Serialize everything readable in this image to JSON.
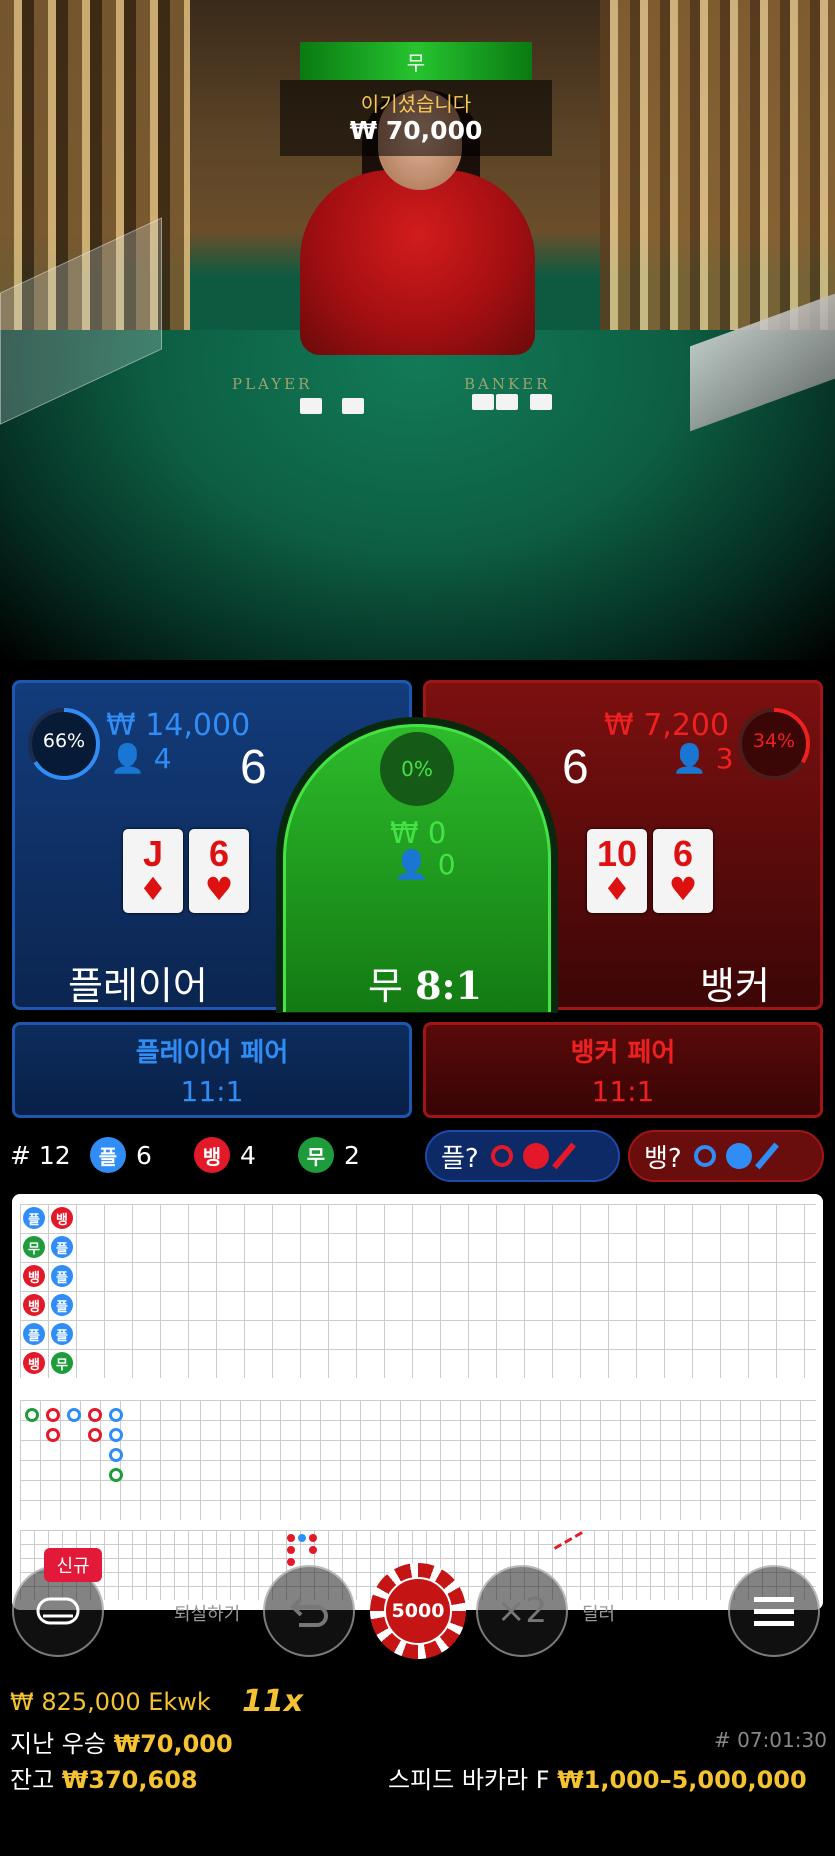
{
  "result": {
    "label": "무",
    "message": "이기셨습니다",
    "amount": "₩ 70,000"
  },
  "table_felt": {
    "player_text": "PLAYER",
    "banker_text": "BANKER"
  },
  "player": {
    "percent": "66%",
    "percent_value": 0.66,
    "bet_total": "₩ 14,000",
    "bettors": "4",
    "score": "6",
    "cards": [
      {
        "rank": "J",
        "suit": "♦"
      },
      {
        "rank": "6",
        "suit": "♥"
      }
    ],
    "label": "플레이어"
  },
  "tie": {
    "percent": "0%",
    "bet_total": "₩ 0",
    "bettors": "0",
    "label": "무",
    "payout": "8:1"
  },
  "banker": {
    "percent": "34%",
    "percent_value": 0.34,
    "bet_total": "₩ 7,200",
    "bettors": "3",
    "score": "6",
    "cards": [
      {
        "rank": "10",
        "suit": "♦"
      },
      {
        "rank": "6",
        "suit": "♥"
      }
    ],
    "label": "뱅커"
  },
  "pairs": {
    "player_pair": {
      "label": "플레이어 페어",
      "payout": "11:1"
    },
    "banker_pair": {
      "label": "뱅커 페어",
      "payout": "11:1"
    }
  },
  "stats": {
    "round": "# 12",
    "player": {
      "glyph": "플",
      "count": "6"
    },
    "banker": {
      "glyph": "뱅",
      "count": "4"
    },
    "tie": {
      "glyph": "무",
      "count": "2"
    }
  },
  "predict": {
    "player_label": "플?",
    "banker_label": "뱅?"
  },
  "roadmap": {
    "bead_columns": [
      [
        "플",
        "무",
        "뱅",
        "뱅",
        "플",
        "뱅"
      ],
      [
        "뱅",
        "플",
        "플",
        "플",
        "플",
        "무"
      ]
    ]
  },
  "controls": {
    "lobby_label": "퇴실하기",
    "chip_value": "5000",
    "double_label": "×2",
    "deal_label": "딜러",
    "new_badge": "신규"
  },
  "footer": {
    "jackpot_amount": "₩ 825,000 Ekwk",
    "multiplier": "11x",
    "last_win_label": "지난 우승",
    "last_win_amount": "₩70,000",
    "balance_label": "잔고",
    "balance_amount": "₩370,608",
    "round_id": "# 07:01:30",
    "table_name": "스피드 바카라 F",
    "limits": "₩1,000–5,000,000"
  },
  "colors": {
    "player": "#2f8df5",
    "banker": "#f02020",
    "tie": "#26c42f",
    "gold": "#f5c232"
  }
}
